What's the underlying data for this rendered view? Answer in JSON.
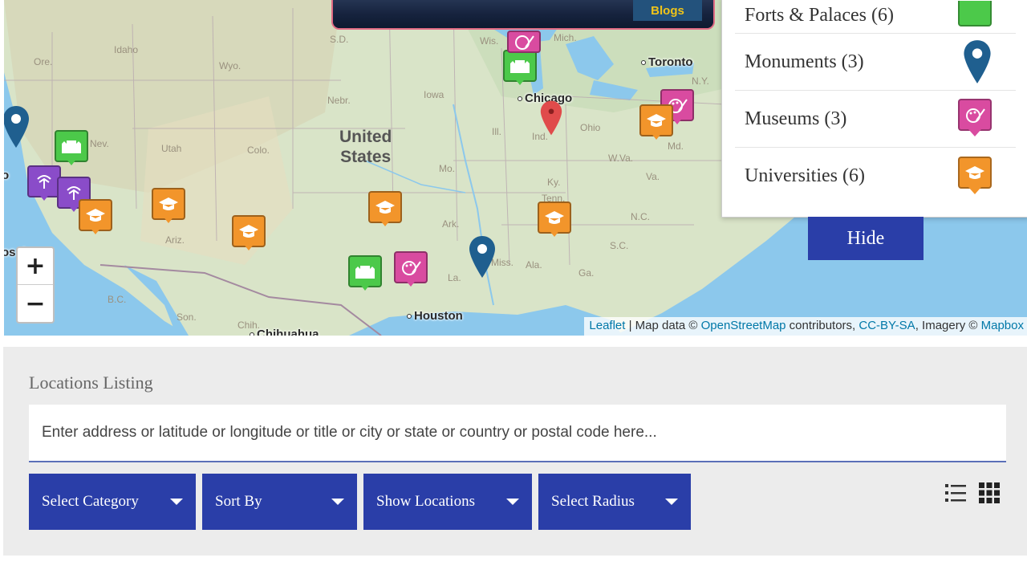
{
  "map": {
    "labels": {
      "states": [
        "S.D.",
        "Wis.",
        "Mich.",
        "Idaho",
        "Ore.",
        "Wyo.",
        "Nebr.",
        "Iowa",
        "Ill.",
        "Ind.",
        "Ohio",
        "N.Y.",
        "Nev.",
        "Utah",
        "Colo.",
        "Mo.",
        "Ky.",
        "W.Va.",
        "Va.",
        "Md.",
        "Ariz.",
        "Ark.",
        "Tenn.",
        "N.C.",
        "S.C.",
        "Ala.",
        "Miss.",
        "La.",
        "Ga.",
        "B.C.",
        "Son.",
        "Chih."
      ],
      "country": "United\nStates",
      "cities": {
        "toronto": "Toronto",
        "chicago": "Chicago",
        "houston": "Houston",
        "chihuahua": "Chihuahua",
        "los_angeles": "os  les",
        "sf": "o"
      }
    },
    "zoom_in": "+",
    "zoom_out": "−",
    "attribution": {
      "leaflet": "Leaflet",
      "sep1": " | Map data © ",
      "osm": "OpenStreetMap",
      "sep2": " contributors, ",
      "license": "CC-BY-SA",
      "sep3": ", Imagery © ",
      "mapbox": "Mapbox"
    },
    "popup_button": "Blogs"
  },
  "legend": {
    "items": [
      {
        "label": "Forts & Palaces (6)",
        "icon": "fort-icon",
        "color": "#4cc94a"
      },
      {
        "label": "Monuments (3)",
        "icon": "monument-pin-icon",
        "color": "#1f5f8f"
      },
      {
        "label": "Museums (3)",
        "icon": "museum-palette-icon",
        "color": "#d94ba0"
      },
      {
        "label": "Universities (6)",
        "icon": "graduation-cap-icon",
        "color": "#f2952b"
      }
    ],
    "hide_label": "Hide"
  },
  "listing": {
    "title": "Locations Listing",
    "search_placeholder": "Enter address or latitude or longitude or title or city or state or country or postal code here...",
    "filters": [
      {
        "label": "Select Category"
      },
      {
        "label": "Sort By"
      },
      {
        "label": "Show Locations"
      },
      {
        "label": "Select Radius"
      }
    ],
    "view_icons": [
      "list-view-icon",
      "grid-view-icon"
    ]
  },
  "colors": {
    "primary": "#2a3ea8",
    "fort": "#4cc94a",
    "university": "#f2952b",
    "museum": "#d94ba0",
    "monument": "#1f5f8f",
    "red_pin": "#e04b4b",
    "ocean": "#8cc8ec"
  }
}
